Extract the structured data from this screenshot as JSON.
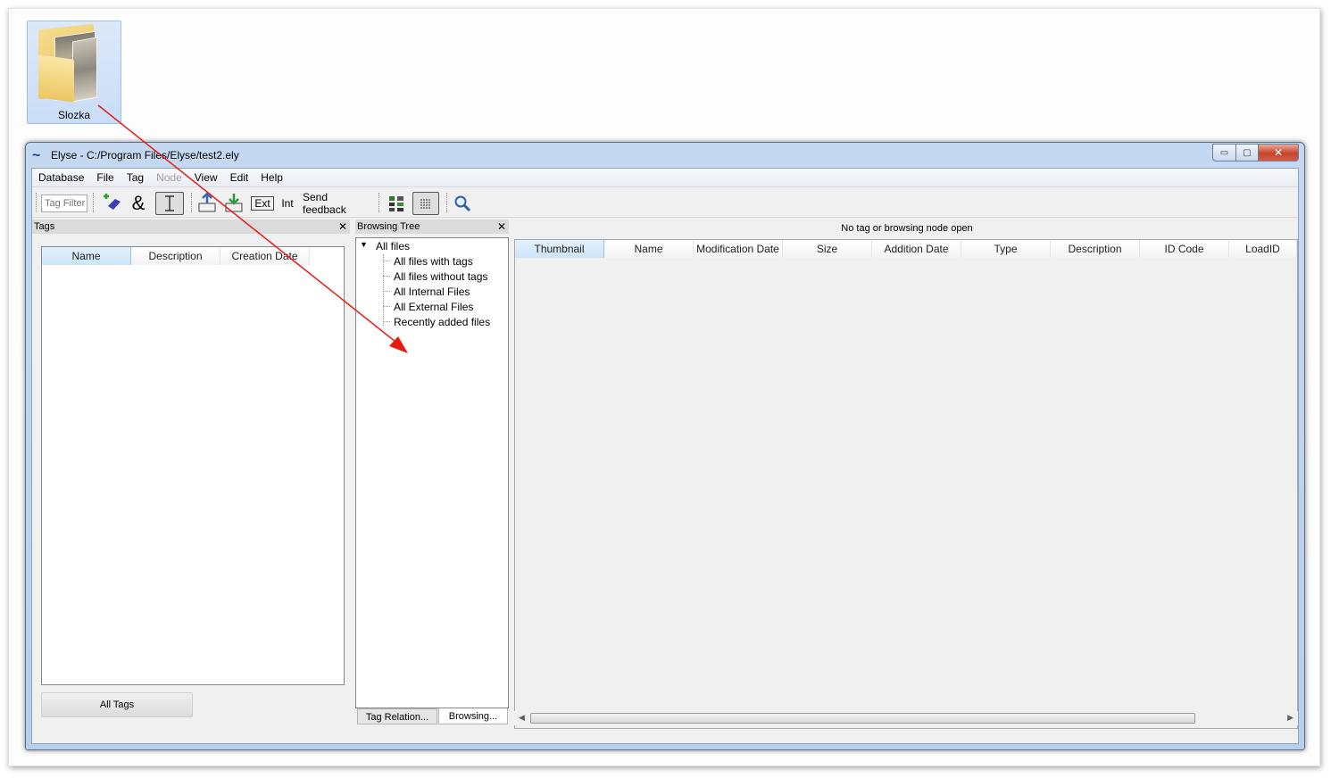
{
  "desktop": {
    "folder_label": "Slozka"
  },
  "window": {
    "title": "Elyse - C:/Program Files/Elyse/test2.ely",
    "controls": {
      "minimize": "▭",
      "maximize": "▢",
      "close": "✕"
    }
  },
  "menu": [
    "Database",
    "File",
    "Tag",
    "Node",
    "View",
    "Edit",
    "Help"
  ],
  "toolbar": {
    "tag_filter_placeholder": "Tag Filter",
    "ampersand": "&",
    "ext_label": "Ext",
    "int_label": "Int",
    "send_feedback": "Send feedback"
  },
  "tags_panel": {
    "title": "Tags",
    "close": "✕",
    "columns": [
      "Name",
      "Description",
      "Creation Date"
    ],
    "all_tags_button": "All Tags"
  },
  "browsing_panel": {
    "title": "Browsing Tree",
    "close": "✕",
    "root": "All files",
    "items": [
      "All files with tags",
      "All files without tags",
      "All Internal Files",
      "All External Files",
      "Recently added files"
    ],
    "tabs": [
      "Tag Relation...",
      "Browsing..."
    ]
  },
  "files_panel": {
    "status": "No tag or browsing node open",
    "columns": [
      "Thumbnail",
      "Name",
      "Modification Date",
      "Size",
      "Addition Date",
      "Type",
      "Description",
      "ID Code",
      "LoadID"
    ]
  },
  "colors": {
    "annotation_arrow": "#e8190f",
    "title_bar": "#c4d9f1",
    "selected_header": "#cbe5f8"
  }
}
